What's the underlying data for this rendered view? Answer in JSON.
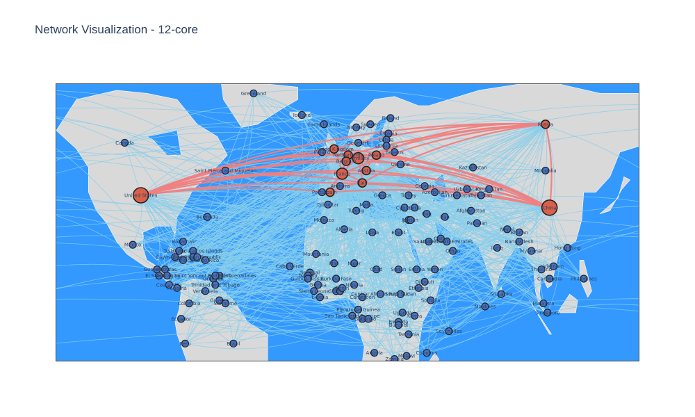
{
  "title": "Network Visualization - 12-core",
  "colors": {
    "ocean": "#3399ff",
    "land": "#d9d9d9",
    "edge_periphery": "#87ceeb",
    "edge_core": "#f08080",
    "node_periphery": "#4a74c4",
    "node_core": "#d9614a",
    "node_stroke": "#222222"
  },
  "map": {
    "projection": "equirectangular",
    "lon_range": [
      -140,
      150
    ],
    "lat_range": [
      -15,
      75
    ]
  },
  "nodes": [
    {
      "name": "United States",
      "lon": -98,
      "lat": 39,
      "core": true,
      "size": "large"
    },
    {
      "name": "China",
      "lon": 105,
      "lat": 35,
      "core": true,
      "size": "large"
    },
    {
      "name": "Russia",
      "lon": 103,
      "lat": 62,
      "core": true,
      "size": "small"
    },
    {
      "name": "United Kingdom",
      "lon": -2,
      "lat": 54,
      "core": true,
      "size": "small"
    },
    {
      "name": "Germany",
      "lon": 10,
      "lat": 51,
      "core": true,
      "size": "medium"
    },
    {
      "name": "France",
      "lon": 2,
      "lat": 46,
      "core": true,
      "size": "medium"
    },
    {
      "name": "Netherlands",
      "lon": 5,
      "lat": 52,
      "core": true,
      "size": "small"
    },
    {
      "name": "Italy",
      "lon": 12,
      "lat": 43,
      "core": true,
      "size": "small"
    },
    {
      "name": "Spain",
      "lon": -4,
      "lat": 40,
      "core": true,
      "size": "small"
    },
    {
      "name": "Poland",
      "lon": 19,
      "lat": 52,
      "core": true,
      "size": "small"
    },
    {
      "name": "Austria",
      "lon": 14,
      "lat": 47,
      "core": true,
      "size": "small"
    },
    {
      "name": "Belgium",
      "lon": 4,
      "lat": 50,
      "core": true,
      "size": "small"
    },
    {
      "name": "Canada",
      "lon": -106,
      "lat": 56,
      "core": false
    },
    {
      "name": "Greenland",
      "lon": -42,
      "lat": 72,
      "core": false
    },
    {
      "name": "Iceland",
      "lon": -18,
      "lat": 65,
      "core": false
    },
    {
      "name": "Faroe Islands",
      "lon": -7,
      "lat": 62,
      "core": false
    },
    {
      "name": "Norway",
      "lon": 9,
      "lat": 61,
      "core": false
    },
    {
      "name": "Sweden",
      "lon": 16,
      "lat": 62,
      "core": false
    },
    {
      "name": "Finland",
      "lon": 26,
      "lat": 64,
      "core": false
    },
    {
      "name": "Estonia",
      "lon": 25,
      "lat": 59,
      "core": false
    },
    {
      "name": "Latvia",
      "lon": 24,
      "lat": 57,
      "core": false
    },
    {
      "name": "Lithuania",
      "lon": 24,
      "lat": 55,
      "core": false
    },
    {
      "name": "Belarus",
      "lon": 28,
      "lat": 53,
      "core": false
    },
    {
      "name": "Ukraine",
      "lon": 31,
      "lat": 49,
      "core": false
    },
    {
      "name": "Denmark",
      "lon": 10,
      "lat": 56,
      "core": false
    },
    {
      "name": "Ireland",
      "lon": -8,
      "lat": 53,
      "core": false
    },
    {
      "name": "Portugal",
      "lon": -8,
      "lat": 40,
      "core": false
    },
    {
      "name": "Andorra",
      "lon": 1,
      "lat": 42,
      "core": false
    },
    {
      "name": "Gibraltar",
      "lon": -5,
      "lat": 36,
      "core": false
    },
    {
      "name": "Malta",
      "lon": 14,
      "lat": 36,
      "core": false
    },
    {
      "name": "Tunisia",
      "lon": 9,
      "lat": 34,
      "core": false
    },
    {
      "name": "Morocco",
      "lon": -7,
      "lat": 31,
      "core": false
    },
    {
      "name": "Algeria",
      "lon": 3,
      "lat": 28,
      "core": false
    },
    {
      "name": "Libya",
      "lon": 17,
      "lat": 27,
      "core": false
    },
    {
      "name": "Egypt",
      "lon": 30,
      "lat": 27,
      "core": false
    },
    {
      "name": "Greece",
      "lon": 22,
      "lat": 39,
      "core": false
    },
    {
      "name": "Turkey",
      "lon": 35,
      "lat": 39,
      "core": false
    },
    {
      "name": "Cyprus",
      "lon": 33,
      "lat": 35,
      "core": false
    },
    {
      "name": "Georgia",
      "lon": 43,
      "lat": 42,
      "core": false
    },
    {
      "name": "Azerbaijan",
      "lon": 48,
      "lat": 40,
      "core": false
    },
    {
      "name": "Kazakhstan",
      "lon": 67,
      "lat": 48,
      "core": false
    },
    {
      "name": "Uzbekistan",
      "lon": 64,
      "lat": 41,
      "core": false
    },
    {
      "name": "Turkmenistan",
      "lon": 59,
      "lat": 39,
      "core": false
    },
    {
      "name": "Kyrgyzstan",
      "lon": 75,
      "lat": 41,
      "core": false
    },
    {
      "name": "Tajikistan",
      "lon": 71,
      "lat": 39,
      "core": false
    },
    {
      "name": "Mongolia",
      "lon": 103,
      "lat": 47,
      "core": false
    },
    {
      "name": "Afghanistan",
      "lon": 66,
      "lat": 34,
      "core": false
    },
    {
      "name": "Pakistan",
      "lon": 69,
      "lat": 30,
      "core": false
    },
    {
      "name": "Iran",
      "lon": 53,
      "lat": 32,
      "core": false
    },
    {
      "name": "Iraq",
      "lon": 44,
      "lat": 33,
      "core": false
    },
    {
      "name": "Syria",
      "lon": 38,
      "lat": 35,
      "core": false
    },
    {
      "name": "Israel",
      "lon": 35,
      "lat": 31,
      "core": false
    },
    {
      "name": "Jordan",
      "lon": 36,
      "lat": 31,
      "core": false
    },
    {
      "name": "Saudi Arabia",
      "lon": 45,
      "lat": 24,
      "core": false
    },
    {
      "name": "United Arab Emirates",
      "lon": 54,
      "lat": 24,
      "core": false
    },
    {
      "name": "Qatar",
      "lon": 51,
      "lat": 25,
      "core": false
    },
    {
      "name": "Oman",
      "lon": 57,
      "lat": 21,
      "core": false
    },
    {
      "name": "Yemen",
      "lon": 48,
      "lat": 15,
      "core": false
    },
    {
      "name": "Eritrea",
      "lon": 39,
      "lat": 15,
      "core": false
    },
    {
      "name": "India",
      "lon": 79,
      "lat": 22,
      "core": false
    },
    {
      "name": "Nepal",
      "lon": 84,
      "lat": 28,
      "core": false
    },
    {
      "name": "Bhutan",
      "lon": 90,
      "lat": 27,
      "core": false
    },
    {
      "name": "Bangladesh",
      "lon": 90,
      "lat": 24,
      "core": false
    },
    {
      "name": "Myanmar",
      "lon": 96,
      "lat": 21,
      "core": false
    },
    {
      "name": "Thailand",
      "lon": 101,
      "lat": 15,
      "core": false
    },
    {
      "name": "Vietnam",
      "lon": 107,
      "lat": 16,
      "core": false
    },
    {
      "name": "Cambodia",
      "lon": 105,
      "lat": 12,
      "core": false
    },
    {
      "name": "Malaysia",
      "lon": 102,
      "lat": 4,
      "core": false
    },
    {
      "name": "Singapore",
      "lon": 104,
      "lat": 1,
      "core": false
    },
    {
      "name": "Sri Lanka",
      "lon": 81,
      "lat": 7,
      "core": false
    },
    {
      "name": "Maldives",
      "lon": 73,
      "lat": 3,
      "core": false
    },
    {
      "name": "Hong Kong",
      "lon": 114,
      "lat": 22,
      "core": false
    },
    {
      "name": "Mexico",
      "lon": -102,
      "lat": 23,
      "core": false
    },
    {
      "name": "Bermuda",
      "lon": -65,
      "lat": 32,
      "core": false
    },
    {
      "name": "Saint Pierre and Miquelon",
      "lon": -56,
      "lat": 47,
      "core": false
    },
    {
      "name": "Bahamas",
      "lon": -77,
      "lat": 24,
      "core": false
    },
    {
      "name": "Cayman Islands",
      "lon": -81,
      "lat": 19,
      "core": false
    },
    {
      "name": "Turks and Caicos Islands",
      "lon": -72,
      "lat": 21,
      "core": false
    },
    {
      "name": "Cuba",
      "lon": -79,
      "lat": 21,
      "core": false
    },
    {
      "name": "Jamaica",
      "lon": -77,
      "lat": 18,
      "core": false
    },
    {
      "name": "Haiti",
      "lon": -72,
      "lat": 19,
      "core": false
    },
    {
      "name": "Dominican Republic",
      "lon": -70,
      "lat": 19,
      "core": false
    },
    {
      "name": "Puerto Rico",
      "lon": -66,
      "lat": 18,
      "core": false
    },
    {
      "name": "Barbados",
      "lon": -59,
      "lat": 13,
      "core": false
    },
    {
      "name": "Grenada",
      "lon": -62,
      "lat": 12,
      "core": false
    },
    {
      "name": "Saint Vincent and the Grenadines",
      "lon": -61,
      "lat": 13,
      "core": false
    },
    {
      "name": "Trinidad and Tobago",
      "lon": -61,
      "lat": 10,
      "core": false
    },
    {
      "name": "Guatemala",
      "lon": -90,
      "lat": 15,
      "core": false
    },
    {
      "name": "Honduras",
      "lon": -86,
      "lat": 15,
      "core": false
    },
    {
      "name": "El Salvador",
      "lon": -89,
      "lat": 13,
      "core": false
    },
    {
      "name": "Nicaragua",
      "lon": -85,
      "lat": 13,
      "core": false
    },
    {
      "name": "Costa Rica",
      "lon": -84,
      "lat": 10,
      "core": false
    },
    {
      "name": "Panama",
      "lon": -80,
      "lat": 9,
      "core": false
    },
    {
      "name": "Venezuela",
      "lon": -66,
      "lat": 8,
      "core": false
    },
    {
      "name": "Guyana",
      "lon": -59,
      "lat": 5,
      "core": false
    },
    {
      "name": "Suriname",
      "lon": -56,
      "lat": 4,
      "core": false
    },
    {
      "name": "Colombia",
      "lon": -74,
      "lat": 4,
      "core": false
    },
    {
      "name": "Ecuador",
      "lon": -78,
      "lat": -1,
      "core": false
    },
    {
      "name": "Peru",
      "lon": -76,
      "lat": -9,
      "core": false
    },
    {
      "name": "Brazil",
      "lon": -52,
      "lat": -9,
      "core": false
    },
    {
      "name": "Mauritania",
      "lon": -11,
      "lat": 20,
      "core": false
    },
    {
      "name": "Cabo Verde",
      "lon": -24,
      "lat": 16,
      "core": false
    },
    {
      "name": "Senegal",
      "lon": -14,
      "lat": 14,
      "core": false
    },
    {
      "name": "Gambia",
      "lon": -15,
      "lat": 13,
      "core": false
    },
    {
      "name": "Guinea-Bissau",
      "lon": -15,
      "lat": 12,
      "core": false
    },
    {
      "name": "Guinea",
      "lon": -10,
      "lat": 10,
      "core": false
    },
    {
      "name": "Sierra Leone",
      "lon": -12,
      "lat": 8,
      "core": false
    },
    {
      "name": "Liberia",
      "lon": -9,
      "lat": 6,
      "core": false
    },
    {
      "name": "Mali",
      "lon": -2,
      "lat": 17,
      "core": false
    },
    {
      "name": "Burkina Faso",
      "lon": -1,
      "lat": 12,
      "core": false
    },
    {
      "name": "Ghana",
      "lon": -1,
      "lat": 8,
      "core": false
    },
    {
      "name": "Togo",
      "lon": 1,
      "lat": 8,
      "core": false
    },
    {
      "name": "Benin",
      "lon": 2,
      "lat": 9,
      "core": false
    },
    {
      "name": "Niger",
      "lon": 8,
      "lat": 17,
      "core": false
    },
    {
      "name": "Nigeria",
      "lon": 8,
      "lat": 10,
      "core": false
    },
    {
      "name": "Chad",
      "lon": 19,
      "lat": 15,
      "core": false
    },
    {
      "name": "Sudan",
      "lon": 30,
      "lat": 15,
      "core": false
    },
    {
      "name": "Ethiopia",
      "lon": 40,
      "lat": 9,
      "core": false
    },
    {
      "name": "Djibouti",
      "lon": 43,
      "lat": 11,
      "core": false
    },
    {
      "name": "Somalia",
      "lon": 46,
      "lat": 5,
      "core": false
    },
    {
      "name": "Central African Republic",
      "lon": 21,
      "lat": 7,
      "core": false
    },
    {
      "name": "Cameroon",
      "lon": 12,
      "lat": 6,
      "core": false
    },
    {
      "name": "South Sudan",
      "lon": 31,
      "lat": 7,
      "core": false
    },
    {
      "name": "Sao Tome and Principe",
      "lon": 7,
      "lat": 0,
      "core": false
    },
    {
      "name": "Equatorial Guinea",
      "lon": 10,
      "lat": 2,
      "core": false
    },
    {
      "name": "Gabon",
      "lon": 12,
      "lat": -1,
      "core": false
    },
    {
      "name": "Congo",
      "lon": 15,
      "lat": -1,
      "core": false
    },
    {
      "name": "Uganda",
      "lon": 32,
      "lat": 1,
      "core": false
    },
    {
      "name": "Kenya",
      "lon": 38,
      "lat": 0,
      "core": false
    },
    {
      "name": "Rwanda",
      "lon": 30,
      "lat": -2,
      "core": false
    },
    {
      "name": "Burundi",
      "lon": 30,
      "lat": -3,
      "core": false
    },
    {
      "name": "Tanzania",
      "lon": 35,
      "lat": -6,
      "core": false
    },
    {
      "name": "Seychelles",
      "lon": 55,
      "lat": -5,
      "core": false
    },
    {
      "name": "Angola",
      "lon": 18,
      "lat": -12,
      "core": false
    },
    {
      "name": "Zambia",
      "lon": 28,
      "lat": -14,
      "core": false
    },
    {
      "name": "Malawi",
      "lon": 34,
      "lat": -13,
      "core": false
    },
    {
      "name": "Comoros",
      "lon": 44,
      "lat": -12,
      "core": false
    },
    {
      "name": "Philippines",
      "lon": 122,
      "lat": 12,
      "core": false
    }
  ],
  "core_links": [
    [
      "United States",
      "United Kingdom"
    ],
    [
      "United States",
      "Germany"
    ],
    [
      "United States",
      "France"
    ],
    [
      "United States",
      "Netherlands"
    ],
    [
      "United States",
      "Italy"
    ],
    [
      "United States",
      "Spain"
    ],
    [
      "United States",
      "Belgium"
    ],
    [
      "United States",
      "China"
    ],
    [
      "United States",
      "Russia"
    ],
    [
      "United States",
      "Poland"
    ],
    [
      "United States",
      "Austria"
    ],
    [
      "China",
      "Germany"
    ],
    [
      "China",
      "France"
    ],
    [
      "China",
      "United Kingdom"
    ],
    [
      "China",
      "Netherlands"
    ],
    [
      "China",
      "Italy"
    ],
    [
      "China",
      "Spain"
    ],
    [
      "China",
      "Russia"
    ],
    [
      "China",
      "Poland"
    ],
    [
      "China",
      "Belgium"
    ],
    [
      "China",
      "Austria"
    ],
    [
      "Russia",
      "Germany"
    ],
    [
      "Russia",
      "France"
    ],
    [
      "Russia",
      "Italy"
    ],
    [
      "Russia",
      "Poland"
    ],
    [
      "Russia",
      "Netherlands"
    ],
    [
      "Russia",
      "United Kingdom"
    ],
    [
      "Germany",
      "France"
    ],
    [
      "Germany",
      "United Kingdom"
    ],
    [
      "Germany",
      "Netherlands"
    ],
    [
      "Germany",
      "Italy"
    ],
    [
      "Germany",
      "Poland"
    ],
    [
      "Germany",
      "Austria"
    ],
    [
      "France",
      "Spain"
    ],
    [
      "France",
      "Italy"
    ],
    [
      "France",
      "United Kingdom"
    ],
    [
      "France",
      "Belgium"
    ],
    [
      "Italy",
      "Spain"
    ],
    [
      "Netherlands",
      "Belgium"
    ],
    [
      "Poland",
      "Austria"
    ]
  ]
}
